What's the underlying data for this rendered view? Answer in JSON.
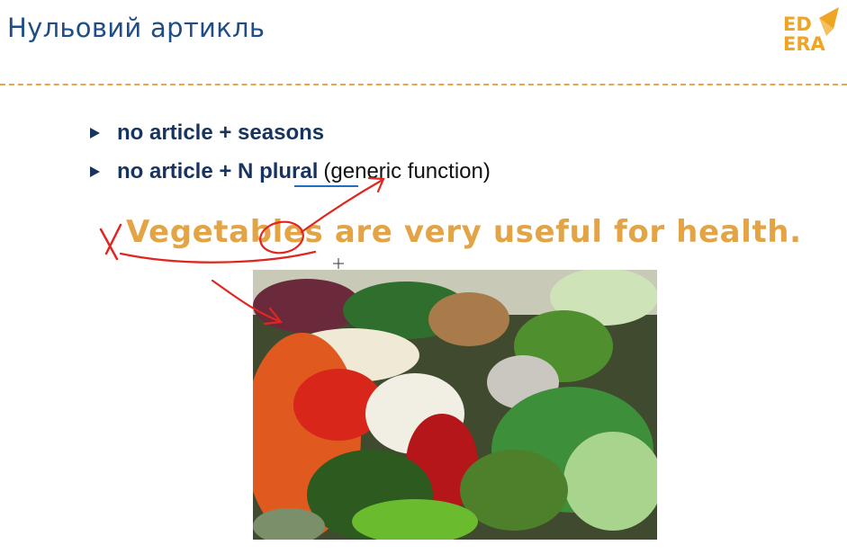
{
  "slide": {
    "title": "Нульовий артикль",
    "logo": {
      "line1": "ED",
      "line2": "ERA",
      "icon": "paper-plane-icon",
      "color": "#f0a423"
    }
  },
  "bullets": [
    {
      "pre": "no article + seasons"
    },
    {
      "pre": "no article + N",
      "term": "plural",
      "note": "(generic function)"
    }
  ],
  "example": {
    "sentence": "Vegetables are very useful for health."
  },
  "photo": {
    "subject": "vegetables-market-photo"
  },
  "colors": {
    "title": "#1f4e87",
    "bullet_text": "#16345e",
    "accent": "#e3a445",
    "ink": "#e0261f"
  }
}
